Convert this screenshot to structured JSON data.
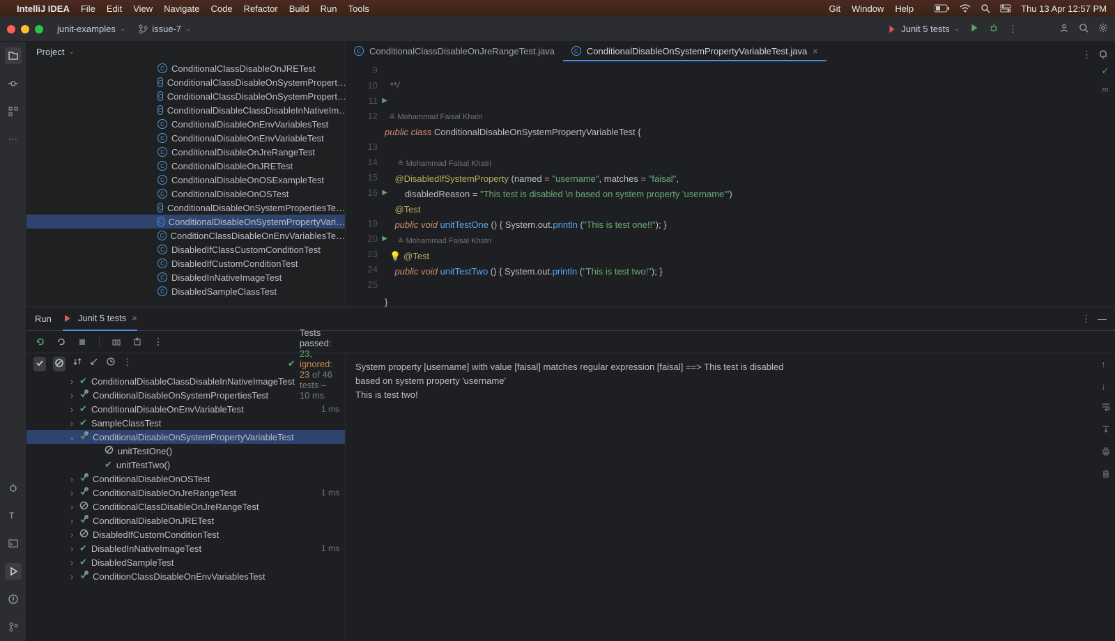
{
  "menubar": {
    "app": "IntelliJ IDEA",
    "items": [
      "File",
      "Edit",
      "View",
      "Navigate",
      "Code",
      "Refactor",
      "Build",
      "Run",
      "Tools"
    ],
    "right_items": [
      "Git",
      "Window",
      "Help"
    ],
    "clock": "Thu 13 Apr  12:57 PM"
  },
  "toolbar": {
    "project": "junit-examples",
    "branch": "issue-7",
    "run_config": "Junit 5 tests"
  },
  "project_view": {
    "title": "Project",
    "items": [
      "ConditionalClassDisableOnJRETest",
      "ConditionalClassDisableOnSystemPropert…",
      "ConditionalClassDisableOnSystemPropert…",
      "ConditionalDisableClassDisableInNativeIm…",
      "ConditionalDisableOnEnvVariablesTest",
      "ConditionalDisableOnEnvVariableTest",
      "ConditionalDisableOnJreRangeTest",
      "ConditionalDisableOnJRETest",
      "ConditionalDisableOnOSExampleTest",
      "ConditionalDisableOnOSTest",
      "ConditionalDisableOnSystemPropertiesTe…",
      "ConditionalDisableOnSystemPropertyVari…",
      "ConditionClassDisableOnEnvVariablesTe…",
      "DisabledIfClassCustomConditionTest",
      "DisabledIfCustomConditionTest",
      "DisabledInNativeImageTest",
      "DisabledSampleClassTest"
    ],
    "selected_index": 11
  },
  "tabs": {
    "items": [
      {
        "label": "ConditionalClassDisableOnJreRangeTest.java",
        "active": false
      },
      {
        "label": "ConditionalDisableOnSystemPropertyVariableTest.java",
        "active": true
      }
    ]
  },
  "editor": {
    "author": "Mohammad Faisal Khatri",
    "lines": {
      "l9": "  **/",
      "l11": "public class ConditionalDisableOnSystemPropertyVariableTest {",
      "l13": "    @DisabledIfSystemProperty (named = \"username\", matches = \"faisal\",",
      "l14": "        disabledReason = \"This test is disabled \\n based on system property 'username'\")",
      "l15": "    @Test",
      "l16": "    public void unitTestOne () { System.out.println (\"This is test one!!\"); }",
      "l19": "    @Test",
      "l20": "    public void unitTestTwo () { System.out.println (\"This is test two!\"); }",
      "l24": "}"
    }
  },
  "run": {
    "tab_run": "Run",
    "tab_name": "Junit 5 tests",
    "summary": {
      "prefix": "Tests passed: ",
      "passed": "23",
      "ignored_label": ", ignored: ",
      "ignored": "23",
      "of_label": " of 46 tests",
      "time": " – 10 ms"
    },
    "tree": [
      {
        "indent": 60,
        "chev": ">",
        "status": "pass",
        "label": "ConditionalDisableClassDisableInNativeImageTest"
      },
      {
        "indent": 60,
        "chev": ">",
        "status": "mix",
        "label": "ConditionalDisableOnSystemPropertiesTest"
      },
      {
        "indent": 60,
        "chev": ">",
        "status": "pass",
        "label": "ConditionalDisableOnEnvVariableTest",
        "dur": "1 ms"
      },
      {
        "indent": 60,
        "chev": ">",
        "status": "pass",
        "label": "SampleClassTest"
      },
      {
        "indent": 60,
        "chev": "v",
        "status": "mix",
        "label": "ConditionalDisableOnSystemPropertyVariableTest",
        "sel": true
      },
      {
        "indent": 96,
        "chev": "",
        "status": "ignore",
        "label": "unitTestOne()"
      },
      {
        "indent": 96,
        "chev": "",
        "status": "pass",
        "label": "unitTestTwo()"
      },
      {
        "indent": 60,
        "chev": ">",
        "status": "mix",
        "label": "ConditionalDisableOnOSTest"
      },
      {
        "indent": 60,
        "chev": ">",
        "status": "mix",
        "label": "ConditionalDisableOnJreRangeTest",
        "dur": "1 ms"
      },
      {
        "indent": 60,
        "chev": ">",
        "status": "ignore",
        "label": "ConditionalClassDisableOnJreRangeTest"
      },
      {
        "indent": 60,
        "chev": ">",
        "status": "mix",
        "label": "ConditionalDisableOnJRETest"
      },
      {
        "indent": 60,
        "chev": ">",
        "status": "ignore",
        "label": "DisabledIfCustomConditionTest"
      },
      {
        "indent": 60,
        "chev": ">",
        "status": "pass",
        "label": "DisabledInNativeImageTest",
        "dur": "1 ms"
      },
      {
        "indent": 60,
        "chev": ">",
        "status": "pass",
        "label": "DisabledSampleTest"
      },
      {
        "indent": 60,
        "chev": ">",
        "status": "mix",
        "label": "ConditionClassDisableOnEnvVariablesTest"
      }
    ],
    "console": {
      "l1": "System property [username] with value [faisal] matches regular expression [faisal] ==> This test is disabled",
      "l2": " based on system property 'username'",
      "l3": "This is test two!"
    }
  }
}
